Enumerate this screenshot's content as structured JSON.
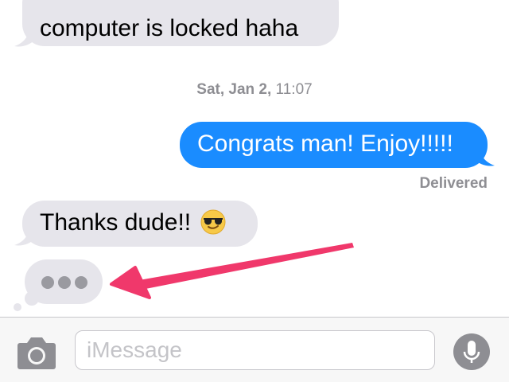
{
  "messages": [
    {
      "direction": "incoming",
      "text": "computer is locked haha"
    },
    {
      "direction": "outgoing",
      "text": "Congrats man! Enjoy!!!!!"
    },
    {
      "direction": "incoming",
      "text": "Thanks dude!!"
    }
  ],
  "timestamp": {
    "day": "Sat, Jan 2,",
    "time": " 11:07"
  },
  "delivered_label": "Delivered",
  "emoji": "smiling-face-with-sunglasses",
  "typing_indicator": {
    "visible": true
  },
  "input": {
    "placeholder": "iMessage",
    "value": ""
  },
  "icons": {
    "camera": "camera-icon",
    "microphone": "microphone-icon"
  },
  "colors": {
    "outgoing_bubble": "#1a8cff",
    "incoming_bubble": "#e6e5eb",
    "annotation_arrow": "#f0386b"
  }
}
